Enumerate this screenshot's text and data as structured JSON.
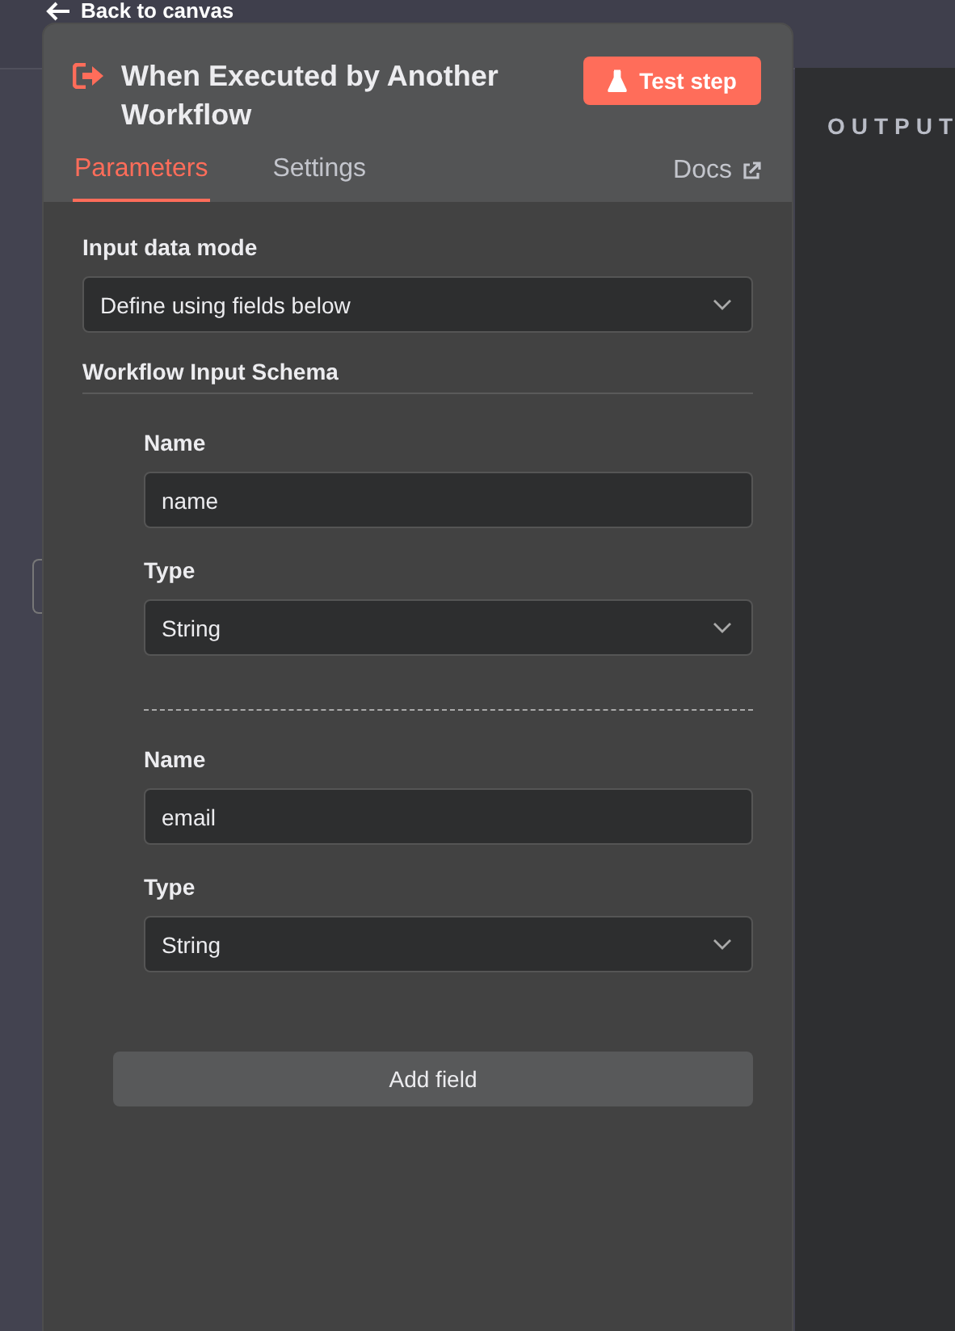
{
  "background": {
    "back_link": "Back to canvas",
    "output_label": "OUTPUT"
  },
  "panel": {
    "title": "When Executed by Another Workflow",
    "test_button": "Test step",
    "tabs": [
      {
        "label": "Parameters",
        "selected": true
      },
      {
        "label": "Settings",
        "selected": false
      }
    ],
    "docs_link": "Docs",
    "input_data_mode": {
      "label": "Input data mode",
      "value": "Define using fields below"
    },
    "schema_heading": "Workflow Input Schema",
    "fields": [
      {
        "name_label": "Name",
        "name_value": "name",
        "type_label": "Type",
        "type_value": "String"
      },
      {
        "name_label": "Name",
        "name_value": "email",
        "type_label": "Type",
        "type_value": "String"
      }
    ],
    "add_button": "Add field"
  }
}
